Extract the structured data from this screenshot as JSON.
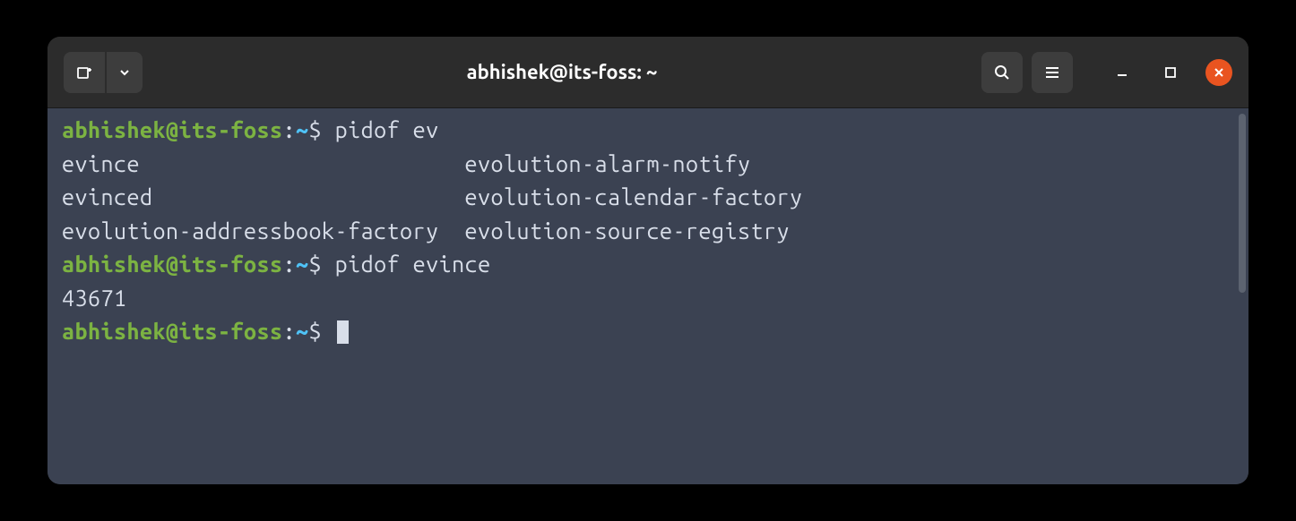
{
  "window": {
    "title": "abhishek@its-foss: ~"
  },
  "prompt": {
    "user_host": "abhishek@its-foss",
    "path": "~",
    "symbol": "$"
  },
  "lines": [
    {
      "type": "prompt",
      "command": "pidof ev"
    },
    {
      "type": "output",
      "text": "evince                         evolution-alarm-notify"
    },
    {
      "type": "output",
      "text": "evinced                        evolution-calendar-factory"
    },
    {
      "type": "output",
      "text": "evolution-addressbook-factory  evolution-source-registry"
    },
    {
      "type": "prompt",
      "command": "pidof evince"
    },
    {
      "type": "output",
      "text": "43671"
    },
    {
      "type": "prompt",
      "command": "",
      "cursor": true
    }
  ],
  "colors": {
    "prompt_user": "#7cb342",
    "prompt_path": "#4fc3f7",
    "terminal_bg": "#3b4252",
    "terminal_fg": "#d8dee9",
    "titlebar_bg": "#2c2c2c",
    "close_btn": "#e95420"
  }
}
